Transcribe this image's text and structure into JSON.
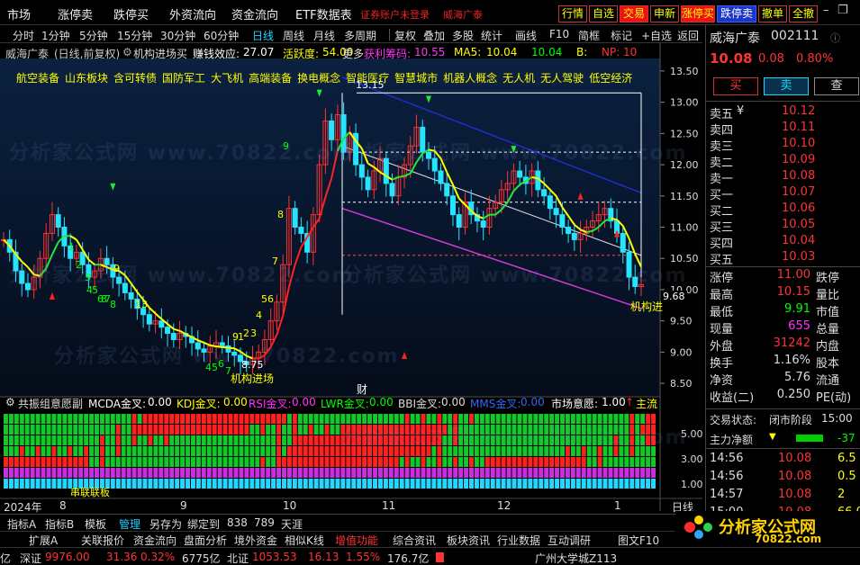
{
  "menu": [
    "市场",
    "涨停卖",
    "跌停买",
    "外资流向",
    "资金流向",
    "ETF数据表"
  ],
  "login_warning": "证券账户未登录",
  "stock_warn": "威海广泰",
  "top_buttons": [
    "行情",
    "自选",
    "交易",
    "申新",
    "涨停买",
    "跌停卖",
    "撤单",
    "全撤"
  ],
  "periods": [
    "分时",
    "1分钟",
    "5分钟",
    "15分钟",
    "30分钟",
    "60分钟",
    "日线",
    "周线",
    "月线",
    "多周期",
    "更多"
  ],
  "period_active": "日线",
  "tools": [
    "复权",
    "叠加",
    "多股",
    "统计",
    "画线",
    "F10",
    "简框",
    "标记",
    "+自选",
    "返回"
  ],
  "chart_header": {
    "name": "威海广泰",
    "mode": "(日线,前复权)",
    "indicator": "机构进场买",
    "zqxy_label": "赚钱效应:",
    "zqxy": "27.07",
    "hyd_label": "活跃度:",
    "hyd": "54.00",
    "more": "更多",
    "hlcm": "获利筹码:",
    "hlcm_v": "10.55",
    "ma5_label": "MA5:",
    "ma5": "10.04",
    "ma_v2": "10.04",
    "b_label": "B:",
    "np_label": "NP:",
    "np_v": "10"
  },
  "concepts": [
    "航空装备",
    "山东板块",
    "含可转债",
    "国防军工",
    "大飞机",
    "高端装备",
    "换电概念",
    "智能医疗",
    "智慧城市",
    "机器人概念",
    "无人机",
    "无人驾驶",
    "低空经济"
  ],
  "watermark": "分析家公式网 www.70822.com",
  "price_axis": [
    "13.50",
    "13.00",
    "12.50",
    "12.00",
    "11.50",
    "11.00",
    "10.50",
    "10.00",
    "9.50",
    "9.00",
    "8.50"
  ],
  "price_axis_min": 8.3,
  "price_axis_max": 13.7,
  "cur_price_tag": "9.68",
  "high_label": "13.15",
  "low_label": "8.75",
  "annot_jg": "机构进场",
  "annot_jg2": "机构进",
  "annot_cai": "财",
  "td_labels": [
    "9",
    "8",
    "7",
    "56",
    "4",
    "3",
    "2",
    "1",
    "9",
    "45",
    "6",
    "7",
    "8",
    "13",
    "1",
    "2",
    "3",
    "4",
    "5",
    "6",
    "7",
    "8",
    "9"
  ],
  "sub_header": {
    "a": "共振组意愿副",
    "b": "MCDA金叉:",
    "b_v": "0.00",
    "c": "KDJ金叉:",
    "c_v": "0.00",
    "d": "RSI金叉:",
    "d_v": "0.00",
    "e": "LWR金叉:",
    "e_v": "0.00",
    "f": "BBI金叉:",
    "f_v": "0.00",
    "g": "MMS金叉:",
    "g_v": "0.00",
    "h": "市场意愿:",
    "h_v": "1.00",
    "i": "主流"
  },
  "sub_axis": [
    "5.00",
    "3.00",
    "1.00"
  ],
  "sub_annot": "串联联板",
  "dates": [
    "2024年",
    "8",
    "9",
    "10",
    "11",
    "12",
    "1"
  ],
  "date_period": "日线",
  "bottom_tabs": [
    "指标A",
    "指标B",
    "模板",
    "管理",
    "另存为",
    "绑定到",
    "838",
    "789",
    "天涯"
  ],
  "bottom_active": "管理",
  "func_bar": [
    "扩展A",
    "关联报价",
    "资金流向",
    "盘面分析",
    "境外资金",
    "相似K线",
    "增值功能",
    "综合资讯",
    "板块资讯",
    "行业数据",
    "互动调研",
    "图文F10"
  ],
  "func_bar_colors": {
    "增值功能": "#ff3b3b"
  },
  "status": {
    "a": "亿",
    "b": "深证",
    "b_v": "9976.00",
    "c": "31.36",
    "d": "0.32%",
    "e": "6775亿",
    "f": "北证",
    "f_v": "1053.53",
    "g": "16.13",
    "h": "1.55%",
    "i": "176.7亿",
    "j": "广州大学城Z113"
  },
  "quote": {
    "name": "威海广泰",
    "code": "002111",
    "price": "10.08",
    "chg": "0.08",
    "pct": "0.80%",
    "buy": "买",
    "sell": "卖",
    "query": "查",
    "asks": [
      [
        "卖五",
        "¥",
        "10.12"
      ],
      [
        "卖四",
        "",
        "10.11"
      ],
      [
        "卖三",
        "",
        "10.10"
      ],
      [
        "卖二",
        "",
        "10.09"
      ],
      [
        "卖一",
        "",
        "10.08"
      ]
    ],
    "bids": [
      [
        "买一",
        "",
        "10.07"
      ],
      [
        "买二",
        "",
        "10.06"
      ],
      [
        "买三",
        "",
        "10.05"
      ],
      [
        "买四",
        "",
        "10.04"
      ],
      [
        "买五",
        "",
        "10.03"
      ]
    ],
    "stats": [
      [
        "涨停",
        "11.00",
        "跌停"
      ],
      [
        "最高",
        "10.15",
        "量比"
      ],
      [
        "最低",
        "9.91",
        "市值"
      ],
      [
        "现量",
        "655",
        "总量"
      ],
      [
        "外盘",
        "31242",
        "内盘"
      ],
      [
        "换手",
        "1.16%",
        "股本"
      ],
      [
        "净资",
        "5.76",
        "流通"
      ],
      [
        "收益(二)",
        "0.250",
        "PE(动)"
      ]
    ],
    "trade_state_label": "交易状态:",
    "trade_state": "闭市阶段",
    "trade_time": "15:00",
    "main_flow_label": "主力净额",
    "main_flow": "-37",
    "ticks": [
      [
        "14:56",
        "10.08",
        "6.5"
      ],
      [
        "14:56",
        "10.08",
        "0.5"
      ],
      [
        "14:57",
        "10.08",
        "2"
      ],
      [
        "15:00",
        "10.08",
        "66.0"
      ]
    ]
  },
  "logo": {
    "text": "分析家公式网",
    "url": "70822.com"
  },
  "colors": {
    "up": "#ff3333",
    "down": "#25e4ff",
    "yellow": "#ffff00",
    "ma": "#ffff00"
  }
}
